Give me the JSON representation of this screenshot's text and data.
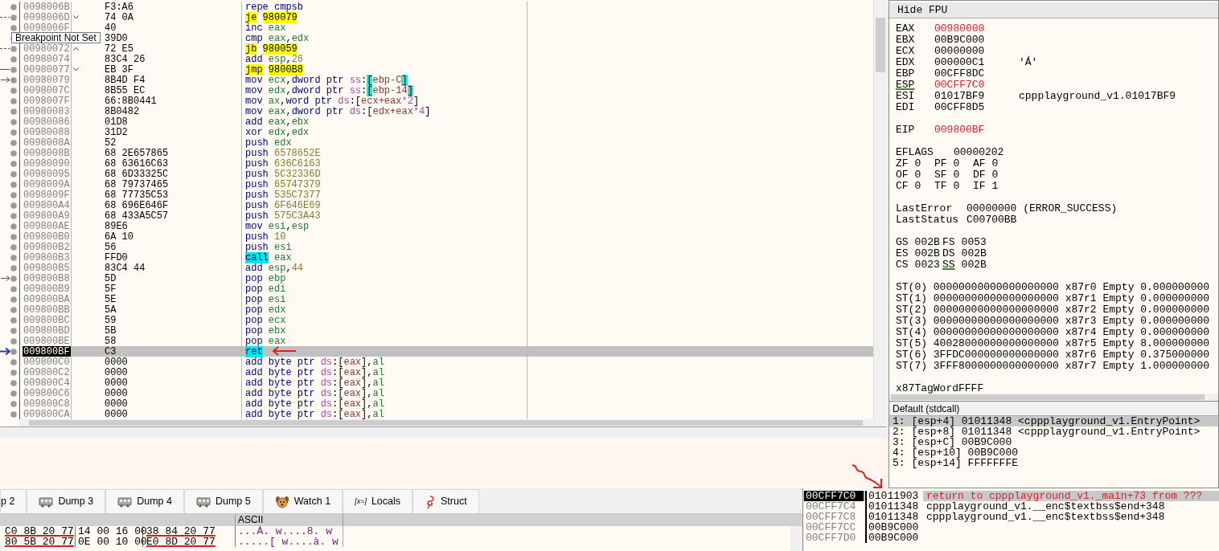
{
  "disassembly": {
    "tooltip": "Breakpoint Not Set",
    "rows": [
      {
        "address": "0098006B",
        "bytes": "F3:A6",
        "mnemonic": {
          "text": "repe cmpsb",
          "kind": "plain"
        },
        "ops": [],
        "selected": false
      },
      {
        "address": "0098006D",
        "bytes": "74 0A",
        "mnemonic": {
          "text": "je",
          "kind": "branch"
        },
        "ops": [
          {
            "text": "980079",
            "kind": "target"
          }
        ],
        "jump_marker": {
          "kind": "down"
        },
        "gutter_marker": {
          "kind": "dash"
        },
        "selected": false
      },
      {
        "address": "0098006F",
        "bytes": "40",
        "mnemonic": {
          "text": "inc",
          "kind": "plain"
        },
        "ops": [
          {
            "text": "eax",
            "kind": "register"
          }
        ],
        "selected": false
      },
      {
        "bytes": "39D0",
        "mnemonic": {
          "text": "cmp",
          "kind": "plain"
        },
        "ops": [
          {
            "text": "eax",
            "kind": "register"
          },
          {
            "text": ",",
            "kind": "punct"
          },
          {
            "text": "edx",
            "kind": "register"
          }
        ],
        "selected": false
      },
      {
        "address": "00980072",
        "bytes": "72 E5",
        "mnemonic": {
          "text": "jb",
          "kind": "branch"
        },
        "ops": [
          {
            "text": "980059",
            "kind": "target"
          }
        ],
        "jump_marker": {
          "kind": "up"
        },
        "gutter_marker": {
          "kind": "dash"
        },
        "selected": false
      },
      {
        "address": "00980074",
        "bytes": "83C4 26",
        "mnemonic": {
          "text": "add",
          "kind": "plain"
        },
        "ops": [
          {
            "text": "esp",
            "kind": "register"
          },
          {
            "text": ",",
            "kind": "punct"
          },
          {
            "text": "26",
            "kind": "number"
          }
        ],
        "selected": false
      },
      {
        "address": "00980077",
        "bytes": "EB 3F",
        "mnemonic": {
          "text": "jmp",
          "kind": "branch"
        },
        "ops": [
          {
            "text": "9800B8",
            "kind": "target"
          }
        ],
        "jump_marker": {
          "kind": "down"
        },
        "gutter_marker": {
          "kind": "line"
        },
        "selected": false
      },
      {
        "address": "00980079",
        "bytes": "8B4D F4",
        "mnemonic": {
          "text": "mov",
          "kind": "plain"
        },
        "ops": [
          {
            "text": "ecx",
            "kind": "register"
          },
          {
            "text": ",",
            "kind": "punct"
          },
          {
            "text": "dword ptr ",
            "kind": "size"
          },
          {
            "text": "ss",
            "kind": "segment"
          },
          {
            "text": ":",
            "kind": "punct"
          },
          {
            "text": "[",
            "kind": "bracket"
          },
          {
            "text": "ebp-C",
            "kind": "memory"
          },
          {
            "text": "]",
            "kind": "bracket"
          }
        ],
        "gutter_marker": {
          "kind": "arrow"
        },
        "selected": false
      },
      {
        "address": "0098007C",
        "bytes": "8B55 EC",
        "mnemonic": {
          "text": "mov",
          "kind": "plain"
        },
        "ops": [
          {
            "text": "edx",
            "kind": "register"
          },
          {
            "text": ",",
            "kind": "punct"
          },
          {
            "text": "dword ptr ",
            "kind": "size"
          },
          {
            "text": "ss",
            "kind": "segment"
          },
          {
            "text": ":",
            "kind": "punct"
          },
          {
            "text": "[",
            "kind": "bracket"
          },
          {
            "text": "ebp-14",
            "kind": "memory"
          },
          {
            "text": "]",
            "kind": "bracket"
          }
        ],
        "selected": false
      },
      {
        "address": "0098007F",
        "bytes": "66:8B0441",
        "mnemonic": {
          "text": "mov",
          "kind": "plain"
        },
        "ops": [
          {
            "text": "ax",
            "kind": "register"
          },
          {
            "text": ",",
            "kind": "punct"
          },
          {
            "text": "word ptr ",
            "kind": "size"
          },
          {
            "text": "ds",
            "kind": "segment"
          },
          {
            "text": ":[",
            "kind": "punct"
          },
          {
            "text": "ecx+eax",
            "kind": "memory"
          },
          {
            "text": "*2",
            "kind": "segment"
          },
          {
            "text": "]",
            "kind": "punct"
          }
        ],
        "selected": false
      },
      {
        "address": "00980083",
        "bytes": "8B0482",
        "mnemonic": {
          "text": "mov",
          "kind": "plain"
        },
        "ops": [
          {
            "text": "eax",
            "kind": "register"
          },
          {
            "text": ",",
            "kind": "punct"
          },
          {
            "text": "dword ptr ",
            "kind": "size"
          },
          {
            "text": "ds",
            "kind": "segment"
          },
          {
            "text": ":[",
            "kind": "punct"
          },
          {
            "text": "edx+eax",
            "kind": "memory"
          },
          {
            "text": "*4",
            "kind": "segment"
          },
          {
            "text": "]",
            "kind": "punct"
          }
        ],
        "selected": false
      },
      {
        "address": "00980086",
        "bytes": "01D8",
        "mnemonic": {
          "text": "add",
          "kind": "plain"
        },
        "ops": [
          {
            "text": "eax",
            "kind": "register"
          },
          {
            "text": ",",
            "kind": "punct"
          },
          {
            "text": "ebx",
            "kind": "register"
          }
        ],
        "selected": false
      },
      {
        "address": "00980088",
        "bytes": "31D2",
        "mnemonic": {
          "text": "xor",
          "kind": "plain"
        },
        "ops": [
          {
            "text": "edx",
            "kind": "register"
          },
          {
            "text": ",",
            "kind": "punct"
          },
          {
            "text": "edx",
            "kind": "register"
          }
        ],
        "selected": false
      },
      {
        "address": "0098008A",
        "bytes": "52",
        "mnemonic": {
          "text": "push",
          "kind": "plain"
        },
        "ops": [
          {
            "text": "edx",
            "kind": "register"
          }
        ],
        "selected": false
      },
      {
        "address": "0098008B",
        "bytes": "68 2E657865",
        "mnemonic": {
          "text": "push",
          "kind": "plain"
        },
        "ops": [
          {
            "text": "6578652E",
            "kind": "number"
          }
        ],
        "selected": false
      },
      {
        "address": "00980090",
        "bytes": "68 63616C63",
        "mnemonic": {
          "text": "push",
          "kind": "plain"
        },
        "ops": [
          {
            "text": "636C6163",
            "kind": "number"
          }
        ],
        "selected": false
      },
      {
        "address": "00980095",
        "bytes": "68 6D33325C",
        "mnemonic": {
          "text": "push",
          "kind": "plain"
        },
        "ops": [
          {
            "text": "5C32336D",
            "kind": "number"
          }
        ],
        "selected": false
      },
      {
        "address": "0098009A",
        "bytes": "68 79737465",
        "mnemonic": {
          "text": "push",
          "kind": "plain"
        },
        "ops": [
          {
            "text": "65747379",
            "kind": "number"
          }
        ],
        "selected": false
      },
      {
        "address": "0098009F",
        "bytes": "68 77735C53",
        "mnemonic": {
          "text": "push",
          "kind": "plain"
        },
        "ops": [
          {
            "text": "535C7377",
            "kind": "number"
          }
        ],
        "selected": false
      },
      {
        "address": "009800A4",
        "bytes": "68 696E646F",
        "mnemonic": {
          "text": "push",
          "kind": "plain"
        },
        "ops": [
          {
            "text": "6F646E69",
            "kind": "number"
          }
        ],
        "selected": false
      },
      {
        "address": "009800A9",
        "bytes": "68 433A5C57",
        "mnemonic": {
          "text": "push",
          "kind": "plain"
        },
        "ops": [
          {
            "text": "575C3A43",
            "kind": "number"
          }
        ],
        "selected": false
      },
      {
        "address": "009800AE",
        "bytes": "89E6",
        "mnemonic": {
          "text": "mov",
          "kind": "plain"
        },
        "ops": [
          {
            "text": "esi",
            "kind": "register"
          },
          {
            "text": ",",
            "kind": "punct"
          },
          {
            "text": "esp",
            "kind": "register"
          }
        ],
        "selected": false
      },
      {
        "address": "009800B0",
        "bytes": "6A 10",
        "mnemonic": {
          "text": "push",
          "kind": "plain"
        },
        "ops": [
          {
            "text": "10",
            "kind": "number"
          }
        ],
        "selected": false
      },
      {
        "address": "009800B2",
        "bytes": "56",
        "mnemonic": {
          "text": "push",
          "kind": "plain"
        },
        "ops": [
          {
            "text": "esi",
            "kind": "register"
          }
        ],
        "selected": false
      },
      {
        "address": "009800B3",
        "bytes": "FFD0",
        "mnemonic": {
          "text": "call",
          "kind": "call"
        },
        "ops": [
          {
            "text": "eax",
            "kind": "register"
          }
        ],
        "selected": false
      },
      {
        "address": "009800B5",
        "bytes": "83C4 44",
        "mnemonic": {
          "text": "add",
          "kind": "plain"
        },
        "ops": [
          {
            "text": "esp",
            "kind": "register"
          },
          {
            "text": ",",
            "kind": "punct"
          },
          {
            "text": "44",
            "kind": "number"
          }
        ],
        "selected": false
      },
      {
        "address": "009800B8",
        "bytes": "5D",
        "mnemonic": {
          "text": "pop",
          "kind": "plain"
        },
        "ops": [
          {
            "text": "ebp",
            "kind": "register"
          }
        ],
        "gutter_marker": {
          "kind": "arrow"
        },
        "selected": false
      },
      {
        "address": "009800B9",
        "bytes": "5F",
        "mnemonic": {
          "text": "pop",
          "kind": "plain"
        },
        "ops": [
          {
            "text": "edi",
            "kind": "register"
          }
        ],
        "selected": false
      },
      {
        "address": "009800BA",
        "bytes": "5E",
        "mnemonic": {
          "text": "pop",
          "kind": "plain"
        },
        "ops": [
          {
            "text": "esi",
            "kind": "register"
          }
        ],
        "selected": false
      },
      {
        "address": "009800BB",
        "bytes": "5A",
        "mnemonic": {
          "text": "pop",
          "kind": "plain"
        },
        "ops": [
          {
            "text": "edx",
            "kind": "register"
          }
        ],
        "selected": false
      },
      {
        "address": "009800BC",
        "bytes": "59",
        "mnemonic": {
          "text": "pop",
          "kind": "plain"
        },
        "ops": [
          {
            "text": "ecx",
            "kind": "register"
          }
        ],
        "selected": false
      },
      {
        "address": "009800BD",
        "bytes": "5B",
        "mnemonic": {
          "text": "pop",
          "kind": "plain"
        },
        "ops": [
          {
            "text": "ebx",
            "kind": "register"
          }
        ],
        "selected": false
      },
      {
        "address": "009800BE",
        "bytes": "58",
        "mnemonic": {
          "text": "pop",
          "kind": "plain"
        },
        "ops": [
          {
            "text": "eax",
            "kind": "register"
          }
        ],
        "selected": false
      },
      {
        "address": "009800BF",
        "bytes": "C3",
        "mnemonic": {
          "text": "ret",
          "kind": "call"
        },
        "ops": [],
        "gutter_marker": {
          "kind": "ip"
        },
        "selected": true
      },
      {
        "address": "009800C0",
        "bytes": "0000",
        "mnemonic": {
          "text": "add",
          "kind": "plain"
        },
        "ops": [
          {
            "text": "byte ptr ",
            "kind": "size"
          },
          {
            "text": "ds",
            "kind": "segment"
          },
          {
            "text": ":[",
            "kind": "punct"
          },
          {
            "text": "eax",
            "kind": "memory"
          },
          {
            "text": "],",
            "kind": "punct"
          },
          {
            "text": "al",
            "kind": "register"
          }
        ],
        "selected": false
      },
      {
        "address": "009800C2",
        "bytes": "0000",
        "mnemonic": {
          "text": "add",
          "kind": "plain"
        },
        "ops": [
          {
            "text": "byte ptr ",
            "kind": "size"
          },
          {
            "text": "ds",
            "kind": "segment"
          },
          {
            "text": ":[",
            "kind": "punct"
          },
          {
            "text": "eax",
            "kind": "memory"
          },
          {
            "text": "],",
            "kind": "punct"
          },
          {
            "text": "al",
            "kind": "register"
          }
        ],
        "selected": false
      },
      {
        "address": "009800C4",
        "bytes": "0000",
        "mnemonic": {
          "text": "add",
          "kind": "plain"
        },
        "ops": [
          {
            "text": "byte ptr ",
            "kind": "size"
          },
          {
            "text": "ds",
            "kind": "segment"
          },
          {
            "text": ":[",
            "kind": "punct"
          },
          {
            "text": "eax",
            "kind": "memory"
          },
          {
            "text": "],",
            "kind": "punct"
          },
          {
            "text": "al",
            "kind": "register"
          }
        ],
        "selected": false
      },
      {
        "address": "009800C6",
        "bytes": "0000",
        "mnemonic": {
          "text": "add",
          "kind": "plain"
        },
        "ops": [
          {
            "text": "byte ptr ",
            "kind": "size"
          },
          {
            "text": "ds",
            "kind": "segment"
          },
          {
            "text": ":[",
            "kind": "punct"
          },
          {
            "text": "eax",
            "kind": "memory"
          },
          {
            "text": "],",
            "kind": "punct"
          },
          {
            "text": "al",
            "kind": "register"
          }
        ],
        "selected": false
      },
      {
        "address": "009800C8",
        "bytes": "0000",
        "mnemonic": {
          "text": "add",
          "kind": "plain"
        },
        "ops": [
          {
            "text": "byte ptr ",
            "kind": "size"
          },
          {
            "text": "ds",
            "kind": "segment"
          },
          {
            "text": ":[",
            "kind": "punct"
          },
          {
            "text": "eax",
            "kind": "memory"
          },
          {
            "text": "],",
            "kind": "punct"
          },
          {
            "text": "al",
            "kind": "register"
          }
        ],
        "selected": false
      },
      {
        "address": "009800CA",
        "bytes": "0000",
        "mnemonic": {
          "text": "add",
          "kind": "plain"
        },
        "ops": [
          {
            "text": "byte ptr ",
            "kind": "size"
          },
          {
            "text": "ds",
            "kind": "segment"
          },
          {
            "text": ":[",
            "kind": "punct"
          },
          {
            "text": "eax",
            "kind": "memory"
          },
          {
            "text": "],",
            "kind": "punct"
          },
          {
            "text": "al",
            "kind": "register"
          }
        ],
        "selected": false
      }
    ]
  },
  "registers": {
    "button": "Hide FPU",
    "groups": [
      [
        {
          "name": "EAX",
          "value": "00980000",
          "changed": true,
          "active": false
        },
        {
          "name": "EBX",
          "value": "00B9C000",
          "changed": false,
          "active": false
        },
        {
          "name": "ECX",
          "value": "00000000",
          "changed": false,
          "active": false
        },
        {
          "name": "EDX",
          "value": "000000C1",
          "changed": false,
          "active": false,
          "comment": "'Á'"
        },
        {
          "name": "EBP",
          "value": "00CFF8DC",
          "changed": false,
          "active": false
        },
        {
          "name": "ESP",
          "value": "00CFF7C0",
          "changed": true,
          "active": true
        },
        {
          "name": "ESI",
          "value": "01017BF9",
          "changed": false,
          "active": false,
          "comment": "cppplayground_v1.01017BF9"
        },
        {
          "name": "EDI",
          "value": "00CFF8D5",
          "changed": false,
          "active": false
        }
      ],
      [
        {
          "name": "EIP",
          "value": "009800BF",
          "changed": true,
          "active": false
        }
      ]
    ],
    "eflags": {
      "name": "EFLAGS",
      "value": "00000202"
    },
    "flags": [
      {
        "name": "ZF",
        "value": "0"
      },
      {
        "name": "PF",
        "value": "0"
      },
      {
        "name": "AF",
        "value": "0"
      },
      {
        "name": "OF",
        "value": "0"
      },
      {
        "name": "SF",
        "value": "0"
      },
      {
        "name": "DF",
        "value": "0"
      },
      {
        "name": "CF",
        "value": "0"
      },
      {
        "name": "TF",
        "value": "0"
      },
      {
        "name": "IF",
        "value": "1"
      }
    ],
    "last_error": {
      "label": "LastError",
      "value": "00000000 (ERROR_SUCCESS)"
    },
    "last_status": {
      "label": "LastStatus",
      "value": "C00700BB"
    },
    "segments": [
      {
        "name": "GS",
        "value": "002B",
        "active": false
      },
      {
        "name": "FS",
        "value": "0053",
        "active": false
      },
      {
        "name": "ES",
        "value": "002B",
        "active": false
      },
      {
        "name": "DS",
        "value": "002B",
        "active": false
      },
      {
        "name": "CS",
        "value": "0023",
        "active": false
      },
      {
        "name": "SS",
        "value": "002B",
        "active": true
      }
    ],
    "fpu": [
      {
        "name": "ST(0)",
        "raw": "00000000000000000000",
        "reg": "x87r0",
        "tag": "Empty",
        "value": "0.000000000"
      },
      {
        "name": "ST(1)",
        "raw": "00000000000000000000",
        "reg": "x87r1",
        "tag": "Empty",
        "value": "0.000000000"
      },
      {
        "name": "ST(2)",
        "raw": "00000000000000000000",
        "reg": "x87r2",
        "tag": "Empty",
        "value": "0.000000000"
      },
      {
        "name": "ST(3)",
        "raw": "00000000000000000000",
        "reg": "x87r3",
        "tag": "Empty",
        "value": "0.000000000"
      },
      {
        "name": "ST(4)",
        "raw": "00000000000000000000",
        "reg": "x87r4",
        "tag": "Empty",
        "value": "0.000000000"
      },
      {
        "name": "ST(5)",
        "raw": "40028000000000000000",
        "reg": "x87r5",
        "tag": "Empty",
        "value": "8.000000000"
      },
      {
        "name": "ST(6)",
        "raw": "3FFDC000000000000000",
        "reg": "x87r6",
        "tag": "Empty",
        "value": "0.375000000"
      },
      {
        "name": "ST(7)",
        "raw": "3FFF8000000000000000",
        "reg": "x87r7",
        "tag": "Empty",
        "value": "1.000000000"
      }
    ],
    "tag_word": {
      "label": "x87TagWord",
      "value": "FFFF"
    }
  },
  "call_stack": {
    "title": "Default (stdcall)",
    "rows": [
      {
        "text": "1: [esp+4] 01011348 <cppplayground_v1.EntryPoint>",
        "selected": true
      },
      {
        "text": "2: [esp+8] 01011348 <cppplayground_v1.EntryPoint>",
        "selected": false
      },
      {
        "text": "3: [esp+C] 00B9C000",
        "selected": false
      },
      {
        "text": "4: [esp+10] 00B9C000",
        "selected": false
      },
      {
        "text": "5: [esp+14] FFFFFFFE",
        "selected": false
      }
    ]
  },
  "bottom_tabs": [
    {
      "label": "p 2",
      "kind": "cut",
      "selected": false
    },
    {
      "label": "Dump 3",
      "kind": "dump",
      "selected": false
    },
    {
      "label": "Dump 4",
      "kind": "dump",
      "selected": false
    },
    {
      "label": "Dump 5",
      "kind": "dump",
      "selected": false
    },
    {
      "label": "Watch 1",
      "kind": "watch",
      "selected": false
    },
    {
      "label": "Locals",
      "kind": "locals",
      "icon_text": "[x=]",
      "selected": false
    },
    {
      "label": "Struct",
      "kind": "struct",
      "selected": false
    }
  ],
  "dump": {
    "ascii_header": "ASCII",
    "rows": [
      {
        "groups": [
          {
            "text": "C0 8B 20 77",
            "marked": true
          },
          {
            "text": "14 00 16 00",
            "marked": false
          },
          {
            "text": "38 84 20 77",
            "marked": true
          }
        ],
        "ascii": "...À. w....8. w"
      },
      {
        "groups": [
          {
            "text": "80 5B 20 77",
            "marked": true
          },
          {
            "text": "0E 00 10 00",
            "marked": false
          },
          {
            "text": "E0 8D 20 77",
            "marked": true
          }
        ],
        "ascii": ".....[ w....à. w"
      }
    ]
  },
  "stack": {
    "rows": [
      {
        "address": "00CFF7C0",
        "value": "01011903",
        "comment": "return to cppplayground_v1._main+73 from ???",
        "kind": "return",
        "selected": true
      },
      {
        "address": "00CFF7C4",
        "value": "01011348",
        "comment": "cppplayground_v1.__enc$textbss$end+348",
        "kind": "plain",
        "selected": false
      },
      {
        "address": "00CFF7C8",
        "value": "01011348",
        "comment": "cppplayground_v1.__enc$textbss$end+348",
        "kind": "plain",
        "selected": false
      },
      {
        "address": "00CFF7CC",
        "value": "00B9C000",
        "selected": false
      },
      {
        "address": "00CFF7D0",
        "value": "00B9C000",
        "selected": false
      }
    ]
  }
}
